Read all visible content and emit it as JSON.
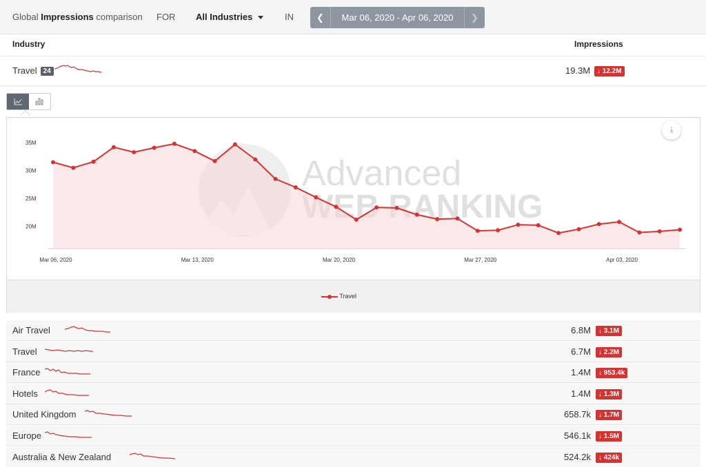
{
  "header": {
    "prefix": "Global",
    "metric": "Impressions",
    "suffix": "comparison",
    "for_label": "FOR",
    "industry_select": "All Industries",
    "in_label": "IN",
    "date_range": "Mar 06, 2020 - Apr 06, 2020",
    "prev_icon": "chevron-left-icon",
    "next_icon": "chevron-right-icon"
  },
  "table": {
    "col_industry": "Industry",
    "col_impressions": "Impressions"
  },
  "main_row": {
    "name": "Travel",
    "count": "24",
    "value": "19.3M",
    "delta": "↓ 12.2M"
  },
  "chart_toggle": {
    "line_icon": "line-chart-icon",
    "bar_icon": "bar-chart-icon"
  },
  "watermark": {
    "line1": "Advanced",
    "line2": "WEB RANKING"
  },
  "chart_data": {
    "type": "area",
    "x": [
      "Mar 06",
      "Mar 07",
      "Mar 08",
      "Mar 09",
      "Mar 10",
      "Mar 11",
      "Mar 12",
      "Mar 13",
      "Mar 14",
      "Mar 15",
      "Mar 16",
      "Mar 17",
      "Mar 18",
      "Mar 19",
      "Mar 20",
      "Mar 21",
      "Mar 22",
      "Mar 23",
      "Mar 24",
      "Mar 25",
      "Mar 26",
      "Mar 27",
      "Mar 28",
      "Mar 29",
      "Mar 30",
      "Mar 31",
      "Apr 01",
      "Apr 02",
      "Apr 03",
      "Apr 04",
      "Apr 05",
      "Apr 06"
    ],
    "x_ticks": [
      "Mar 06, 2020",
      "Mar 13, 2020",
      "Mar 20, 2020",
      "Mar 27, 2020",
      "Apr 03, 2020"
    ],
    "y_ticks": [
      "20M",
      "25M",
      "30M",
      "35M"
    ],
    "ylim": [
      16.0,
      37.0
    ],
    "series": [
      {
        "name": "Travel",
        "color": "#d63232",
        "values": [
          31.5,
          30.5,
          31.6,
          34.2,
          33.3,
          34.1,
          34.8,
          33.5,
          31.7,
          34.7,
          32.0,
          28.5,
          27.0,
          25.2,
          23.5,
          21.2,
          23.4,
          23.3,
          22.1,
          21.3,
          21.4,
          19.2,
          19.3,
          20.3,
          20.2,
          18.8,
          19.5,
          20.4,
          20.8,
          18.9,
          19.1,
          19.4
        ]
      }
    ],
    "legend": "bottom-center",
    "grid": false,
    "download_icon": "download-icon"
  },
  "sub_rows": [
    {
      "name": "Air Travel",
      "value": "6.8M",
      "delta": "↓ 3.1M"
    },
    {
      "name": "Travel",
      "value": "6.7M",
      "delta": "↓ 2.2M"
    },
    {
      "name": "France",
      "value": "1.4M",
      "delta": "↓ 953.4k"
    },
    {
      "name": "Hotels",
      "value": "1.4M",
      "delta": "↓ 1.3M"
    },
    {
      "name": "United Kingdom",
      "value": "658.7k",
      "delta": "↓ 1.7M"
    },
    {
      "name": "Europe",
      "value": "546.1k",
      "delta": "↓ 1.5M"
    },
    {
      "name": "Australia & New Zealand",
      "value": "524.2k",
      "delta": "↓ 424k"
    }
  ]
}
